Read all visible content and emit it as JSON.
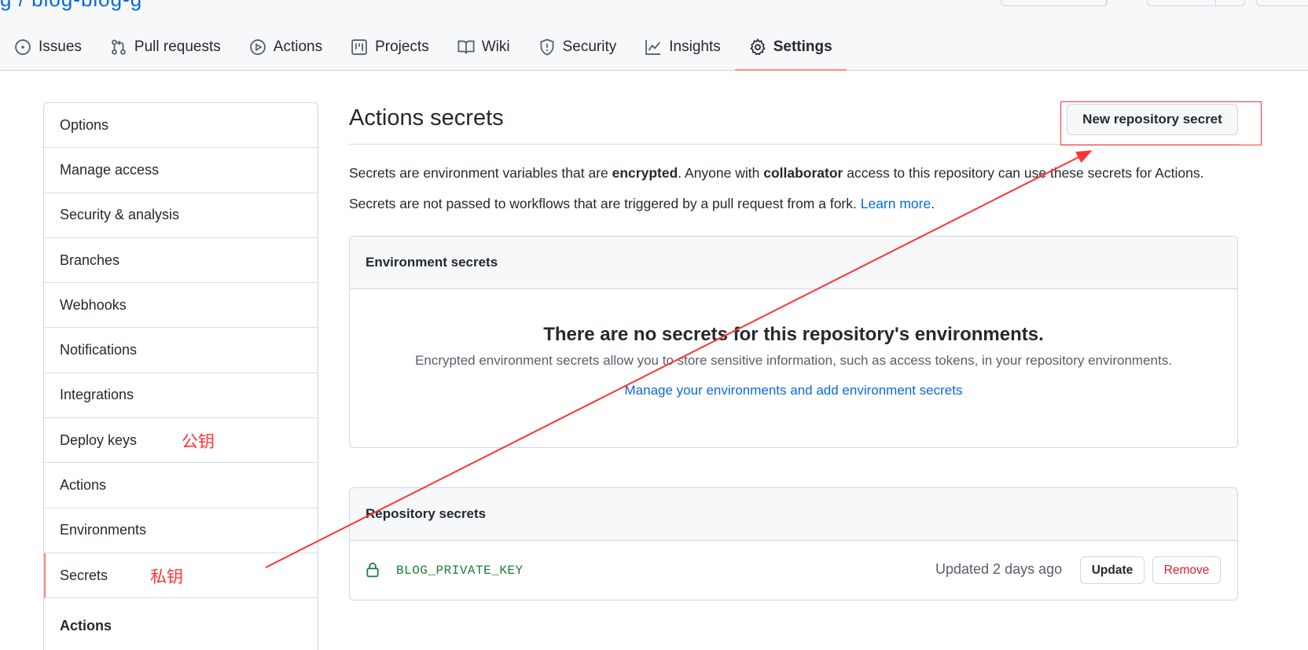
{
  "repo_title": "g / blog-blog-g",
  "tabs": [
    {
      "label": "Issues",
      "icon": "issue-icon"
    },
    {
      "label": "Pull requests",
      "icon": "pull-request-icon"
    },
    {
      "label": "Actions",
      "icon": "play-icon"
    },
    {
      "label": "Projects",
      "icon": "project-icon"
    },
    {
      "label": "Wiki",
      "icon": "book-icon"
    },
    {
      "label": "Security",
      "icon": "shield-icon"
    },
    {
      "label": "Insights",
      "icon": "graph-icon"
    },
    {
      "label": "Settings",
      "icon": "gear-icon",
      "active": true
    }
  ],
  "sidebar": {
    "items": [
      {
        "label": "Options"
      },
      {
        "label": "Manage access"
      },
      {
        "label": "Security & analysis"
      },
      {
        "label": "Branches"
      },
      {
        "label": "Webhooks"
      },
      {
        "label": "Notifications"
      },
      {
        "label": "Integrations"
      },
      {
        "label": "Deploy keys",
        "note": "公钥"
      },
      {
        "label": "Actions"
      },
      {
        "label": "Environments"
      },
      {
        "label": "Secrets",
        "note": "私钥",
        "selected": true
      }
    ],
    "section_heading": "Actions"
  },
  "main": {
    "title": "Actions secrets",
    "new_secret_label": "New repository secret",
    "desc1": {
      "p1": "Secrets are environment variables that are ",
      "b1": "encrypted",
      "p2": ". Anyone with ",
      "b2": "collaborator",
      "p3": " access to this repository can use these secrets for Actions."
    },
    "desc2": {
      "text": "Secrets are not passed to workflows that are triggered by a pull request from a fork. ",
      "link": "Learn more",
      "end": "."
    },
    "environment_secrets": {
      "header": "Environment secrets",
      "blank_title": "There are no secrets for this repository's environments.",
      "blank_desc": "Encrypted environment secrets allow you to store sensitive information, such as access tokens, in your repository environments.",
      "blank_link": "Manage your environments and add environment secrets"
    },
    "repository_secrets": {
      "header": "Repository secrets",
      "rows": [
        {
          "name": "BLOG_PRIVATE_KEY",
          "updated": "Updated 2 days ago",
          "update_label": "Update",
          "remove_label": "Remove"
        }
      ]
    }
  },
  "colors": {
    "accent_tab": "#fd8c73",
    "link": "#0969da",
    "annotation": "#ff3333",
    "secret_name": "#1a7f37",
    "danger": "#cf222e"
  }
}
